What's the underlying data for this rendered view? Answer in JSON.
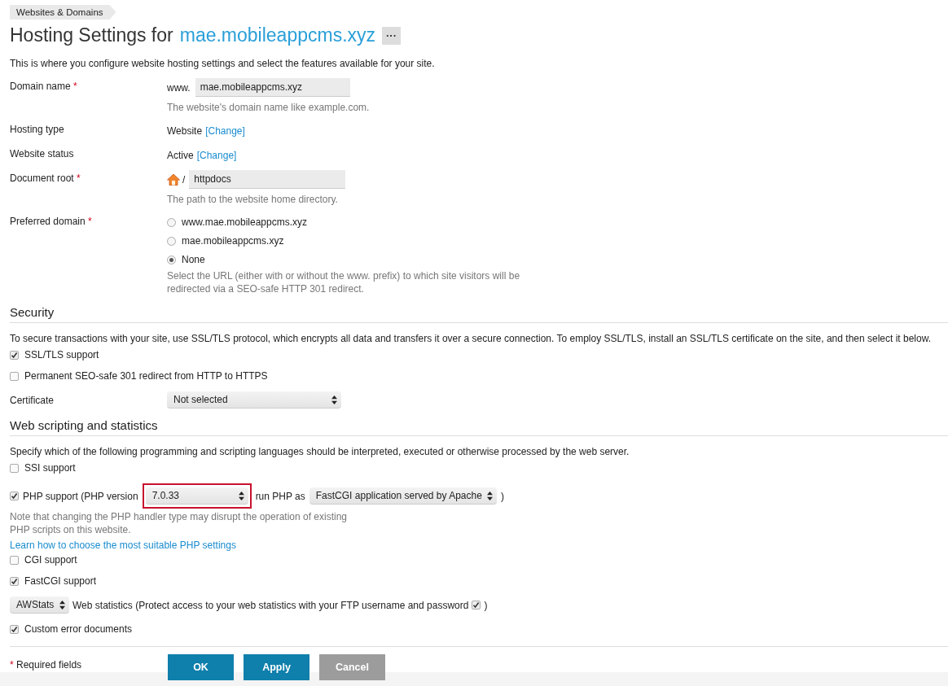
{
  "breadcrumb": "Websites & Domains",
  "title": {
    "prefix": "Hosting Settings for",
    "domain": "mae.mobileappcms.xyz",
    "menu_button": "···"
  },
  "intro": "This is where you configure website hosting settings and select the features available for your site.",
  "fields": [
    {
      "kind": "input",
      "label": "Domain name",
      "required_mark": "*",
      "prefix": "www.",
      "value": "mae.mobileappcms.xyz",
      "hint": "The website's domain name like example.com."
    },
    {
      "kind": "text",
      "label": "Hosting type",
      "value": "Website",
      "link": "[Change]"
    },
    {
      "kind": "text",
      "label": "Website status",
      "value": "Active",
      "link": "[Change]"
    },
    {
      "kind": "path",
      "label": "Document root",
      "required_mark": "*",
      "prefix": "/",
      "value": "httpdocs",
      "hint": "The path to the website home directory."
    },
    {
      "kind": "radio",
      "label": "Preferred domain",
      "required_mark": "*",
      "options": [
        {
          "label": "www.mae.mobileappcms.xyz",
          "selected": false
        },
        {
          "label": "mae.mobileappcms.xyz",
          "selected": false
        },
        {
          "label": "None",
          "selected": true
        }
      ],
      "hint": "Select the URL (either with or without the www. prefix) to which site visitors will be redirected via a SEO-safe HTTP 301 redirect."
    }
  ],
  "sections": [
    {
      "heading": "Security",
      "description": "To secure transactions with your site, use SSL/TLS protocol, which encrypts all data and transfers it over a secure connection. To employ SSL/TLS, install an SSL/TLS certificate on the site, and then select it below.",
      "items": [
        {
          "kind": "checkbox",
          "label": "SSL/TLS support",
          "checked": true
        },
        {
          "kind": "checkbox",
          "label": "Permanent SEO-safe 301 redirect from HTTP to HTTPS",
          "checked": false
        },
        {
          "kind": "select",
          "label": "Certificate",
          "value": "Not selected"
        }
      ]
    },
    {
      "heading": "Web scripting and statistics",
      "description": "Specify which of the following programming and scripting languages should be interpreted, executed or otherwise processed by the web server.",
      "items": [
        {
          "kind": "checkbox",
          "label": "SSI support",
          "checked": false
        },
        {
          "kind": "php",
          "label": "PHP support (PHP version",
          "checked": true,
          "version": "7.0.33",
          "highlighted": true,
          "run_as_label": "run PHP as",
          "handler": "FastCGI application served by Apache",
          "close": ")",
          "note": "Note that changing the PHP handler type may disrupt the operation of existing PHP scripts on this website.",
          "link": "Learn how to choose the most suitable PHP settings"
        },
        {
          "kind": "checkbox",
          "label": "CGI support",
          "checked": false
        },
        {
          "kind": "checkbox",
          "label": "FastCGI support",
          "checked": true
        },
        {
          "kind": "stats",
          "value": "AWStats",
          "label": "Web statistics (Protect access to your web statistics with your FTP username and password",
          "protect_checked": true,
          "close": ")"
        },
        {
          "kind": "checkbox",
          "label": "Custom error documents",
          "checked": true
        }
      ]
    }
  ],
  "footer": {
    "required_mark": "*",
    "required_note": "Required fields",
    "buttons": [
      {
        "label": "OK",
        "kind": "primary"
      },
      {
        "label": "Apply",
        "kind": "primary"
      },
      {
        "label": "Cancel",
        "kind": "secondary"
      }
    ]
  }
}
